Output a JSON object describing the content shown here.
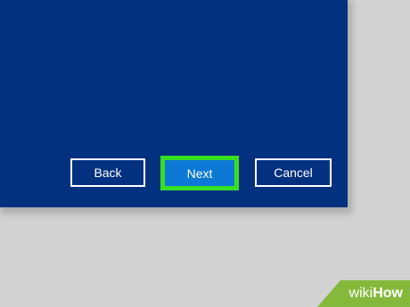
{
  "dialog": {
    "buttons": {
      "back_label": "Back",
      "next_label": "Next",
      "cancel_label": "Cancel"
    }
  },
  "watermark": {
    "part1": "wiki",
    "part2": "How"
  },
  "colors": {
    "dialog_background": "#03317f",
    "page_background": "#d2d2d2",
    "next_button": "#0d78d6",
    "highlight_border": "#35e022",
    "watermark_background": "#85b93b"
  }
}
